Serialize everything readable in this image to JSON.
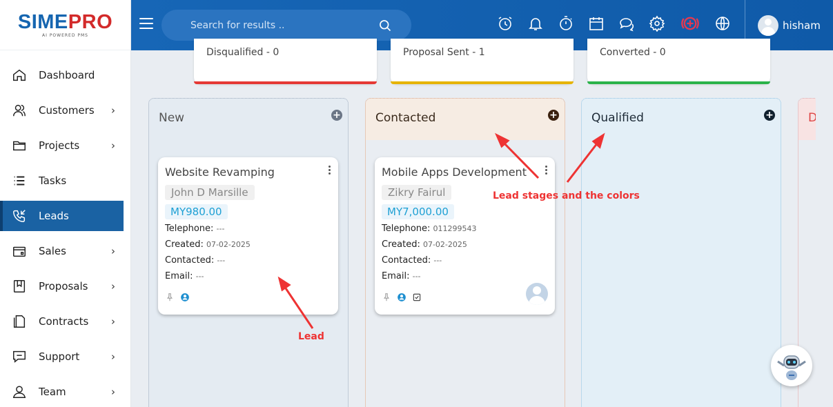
{
  "brand": {
    "name_a": "SIME",
    "name_b": "PRO",
    "tagline": "AI POWERED PMS"
  },
  "search": {
    "placeholder": "Search for results .."
  },
  "user": {
    "name": "hisham"
  },
  "sidebar": {
    "items": [
      {
        "label": "Dashboard",
        "icon": "home-icon",
        "chevron": false,
        "active": false
      },
      {
        "label": "Customers",
        "icon": "users-icon",
        "chevron": true,
        "active": false
      },
      {
        "label": "Projects",
        "icon": "folder-icon",
        "chevron": true,
        "active": false
      },
      {
        "label": "Tasks",
        "icon": "list-icon",
        "chevron": false,
        "active": false
      },
      {
        "label": "Leads",
        "icon": "phone-incoming-icon",
        "chevron": false,
        "active": true
      },
      {
        "label": "Sales",
        "icon": "wallet-icon",
        "chevron": true,
        "active": false
      },
      {
        "label": "Proposals",
        "icon": "bookmark-icon",
        "chevron": true,
        "active": false
      },
      {
        "label": "Contracts",
        "icon": "document-icon",
        "chevron": true,
        "active": false
      },
      {
        "label": "Support",
        "icon": "chat-icon",
        "chevron": true,
        "active": false
      },
      {
        "label": "Team",
        "icon": "person-icon",
        "chevron": true,
        "active": false
      }
    ]
  },
  "summary": [
    {
      "text": "Disqualified - 0",
      "color": "#e53935"
    },
    {
      "text": "Proposal Sent - 1",
      "color": "#e6b400"
    },
    {
      "text": "Converted - 0",
      "color": "#2bb34a"
    }
  ],
  "columns": [
    {
      "title": "New",
      "bg": "#e4ebf2",
      "border": "#9aa9bb",
      "title_color": "#555",
      "plus_color": "#6b7686"
    },
    {
      "title": "Contacted",
      "bg": "#f6ece3",
      "border": "#e2a27a",
      "title_color": "#3a2a1c",
      "plus_color": "#3a200e"
    },
    {
      "title": "Qualified",
      "bg": "#e3eff7",
      "border": "#8cc0e2",
      "title_color": "#1d2a36",
      "plus_color": "#10202e"
    },
    {
      "title": "D",
      "bg": "#f8e3e3",
      "border": "#e8a0a0",
      "title_color": "#d44",
      "plus_color": "#d44"
    }
  ],
  "leads": [
    {
      "title": "Website Revamping",
      "customer": "John D Marsille",
      "amount": "MY980.00",
      "labels": {
        "telephone": "Telephone:",
        "created": "Created:",
        "contacted": "Contacted:",
        "email": "Email:"
      },
      "telephone": "---",
      "created": "07-02-2025",
      "contacted": "---",
      "email": "---"
    },
    {
      "title": "Mobile Apps Development",
      "customer": "Zikry Fairul",
      "amount": "MY7,000.00",
      "labels": {
        "telephone": "Telephone:",
        "created": "Created:",
        "contacted": "Contacted:",
        "email": "Email:"
      },
      "telephone": "011299543",
      "created": "07-02-2025",
      "contacted": "---",
      "email": "---"
    }
  ],
  "annotations": {
    "stages": "Lead stages and the colors",
    "lead": "Lead"
  }
}
